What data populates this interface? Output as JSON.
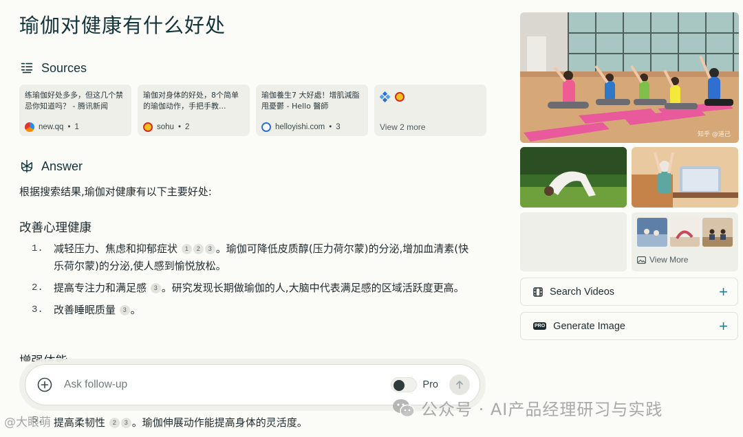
{
  "page": {
    "title": "瑜伽对健康有什么好处"
  },
  "sources": {
    "heading": "Sources",
    "items": [
      {
        "title": "练瑜伽好处多多，但这几个禁忌你知道吗？ - 腾讯新闻",
        "site": "new.qq",
        "index": "1"
      },
      {
        "title": "瑜伽对身体的好处，8个简单的瑜伽动作，手把手教...",
        "site": "sohu",
        "index": "2"
      },
      {
        "title": "瑜伽養生7 大好處！增肌減脂甩憂鬱 - Hello 醫師",
        "site": "helloyishi.com",
        "index": "3"
      }
    ],
    "more_label": "View 2 more"
  },
  "answer": {
    "heading": "Answer",
    "intro": "根据搜索结果,瑜伽对健康有以下主要好处:",
    "section1_title": "改善心理健康",
    "items": [
      {
        "num": "1.",
        "text": "减轻压力、焦虑和抑郁症状",
        "cites": [
          "1",
          "2",
          "3"
        ],
        "tail": "。瑜伽可降低皮质醇(压力荷尔蒙)的分泌,增加血清素(快乐荷尔蒙)的分泌,使人感到愉悦放松。"
      },
      {
        "num": "2.",
        "text": "提高专注力和满足感",
        "cites": [
          "3"
        ],
        "tail": "。研究发现长期做瑜伽的人,大脑中代表满足感的区域活跃度更高。"
      },
      {
        "num": "3.",
        "text": "改善睡眠质量",
        "cites": [
          "3"
        ],
        "tail": "。"
      }
    ],
    "section2_title": "增强体能",
    "bottom_item": {
      "num": "5.",
      "text": "提高柔韧性",
      "cites": [
        "2",
        "3"
      ],
      "tail": "。瑜伽伸展动作能提高身体的灵活度。"
    }
  },
  "followup": {
    "placeholder": "Ask follow-up",
    "pro_label": "Pro"
  },
  "media": {
    "image_caption": "知乎 @道己",
    "view_more_label": "View More",
    "search_videos_label": "Search Videos",
    "generate_image_label": "Generate Image",
    "pro_badge": "PRO"
  },
  "watermark": {
    "text": "公众号 · AI产品经理研习与实践",
    "small": "@大眼萌"
  },
  "colors": {
    "accent": "#1f7f8c",
    "title": "#13343b",
    "card": "#efefea",
    "background": "#fbfbf7"
  }
}
